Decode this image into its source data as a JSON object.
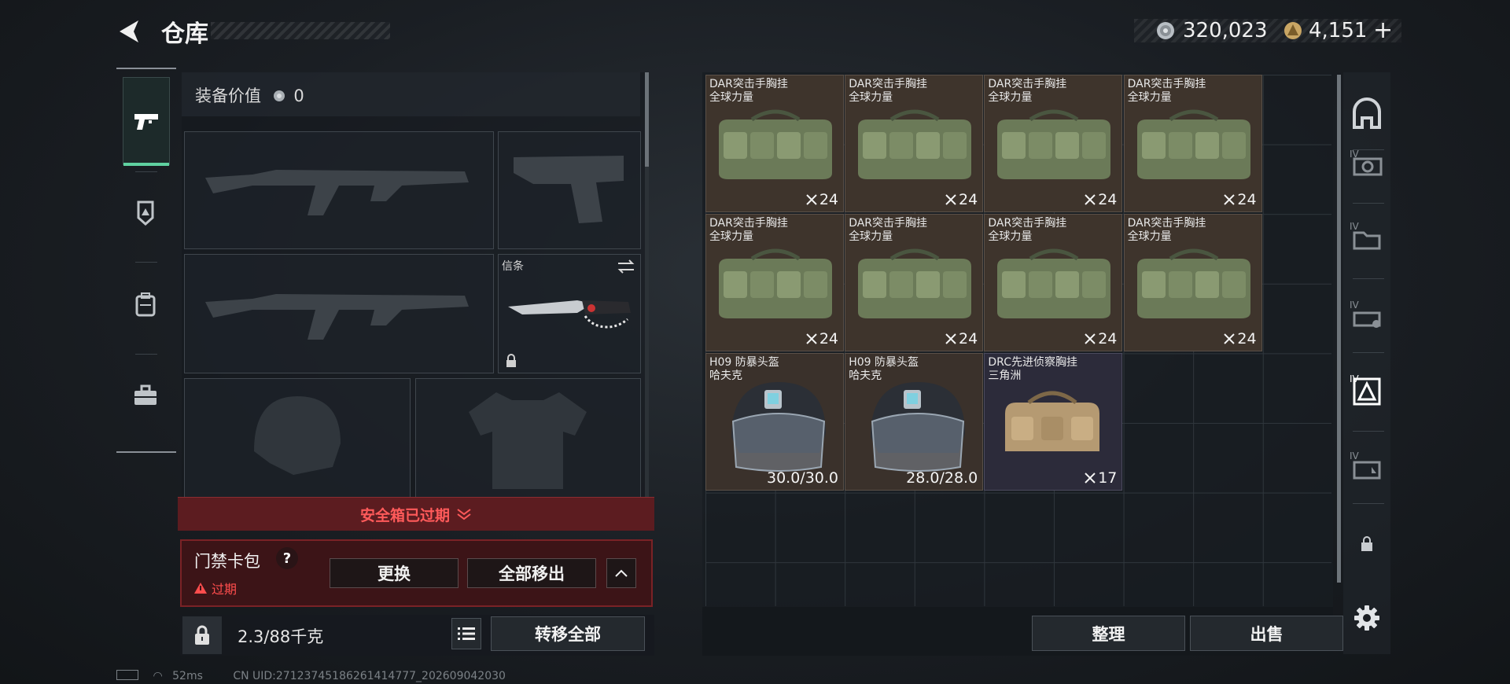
{
  "header": {
    "title": "仓库",
    "currency": [
      {
        "icon": "silver-coin-icon",
        "value": "320,023"
      },
      {
        "icon": "gold-coin-icon",
        "value": "4,151"
      }
    ],
    "add_label": "+"
  },
  "left_tabs": [
    {
      "icon": "pistol-icon",
      "active": true
    },
    {
      "icon": "armor-shield-icon",
      "active": false
    },
    {
      "icon": "backpack-icon",
      "active": false
    },
    {
      "icon": "briefcase-icon",
      "active": false
    }
  ],
  "equipment": {
    "value_label": "装备价值",
    "value": "0",
    "melee_slot_label": "信条",
    "safebox_status": "安全箱已过期",
    "card_pack": {
      "label": "门禁卡包",
      "help": "?",
      "status": "过期",
      "replace_label": "更换",
      "move_all_label": "全部移出"
    },
    "weight": "2.3/88千克",
    "transfer_all_label": "转移全部"
  },
  "storage": {
    "items": [
      {
        "name": "DAR突击手胸挂\n全球力量",
        "count": "24",
        "type": "bag"
      },
      {
        "name": "DAR突击手胸挂\n全球力量",
        "count": "24",
        "type": "bag"
      },
      {
        "name": "DAR突击手胸挂\n全球力量",
        "count": "24",
        "type": "bag"
      },
      {
        "name": "DAR突击手胸挂\n全球力量",
        "count": "24",
        "type": "bag"
      },
      {
        "name": "DAR突击手胸挂\n全球力量",
        "count": "24",
        "type": "bag"
      },
      {
        "name": "DAR突击手胸挂\n全球力量",
        "count": "24",
        "type": "bag"
      },
      {
        "name": "DAR突击手胸挂\n全球力量",
        "count": "24",
        "type": "bag"
      },
      {
        "name": "DAR突击手胸挂\n全球力量",
        "count": "24",
        "type": "bag"
      },
      {
        "name": "H09 防暴头盔\n哈夫克",
        "count": "30.0/30.0",
        "type": "helmet"
      },
      {
        "name": "H09 防暴头盔\n哈夫克",
        "count": "28.0/28.0",
        "type": "helmet"
      },
      {
        "name": "DRC先进侦察胸挂\n三角洲",
        "count": "17",
        "type": "vest"
      }
    ],
    "sort_label": "整理",
    "sell_label": "出售"
  },
  "right_categories": [
    {
      "icon": "all-category-icon"
    },
    {
      "icon": "iv-gun-category-icon"
    },
    {
      "icon": "iv-folder-category-icon"
    },
    {
      "icon": "iv-card-category-icon"
    },
    {
      "icon": "iv-armor-category-icon",
      "active": true
    },
    {
      "icon": "iv-medkit-category-icon"
    },
    {
      "icon": "lock-icon"
    },
    {
      "icon": "settings-gear-icon"
    }
  ],
  "status_bar": {
    "ping": "52ms",
    "uid": "CN UID:27123745186261414777_202609042030"
  }
}
